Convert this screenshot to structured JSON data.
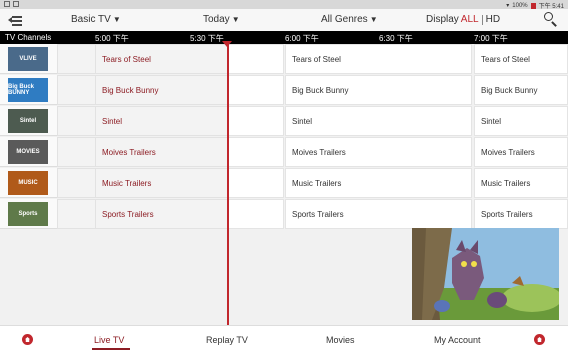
{
  "status_bar": {
    "battery": "100%",
    "time": "下午 5:41"
  },
  "top_nav": {
    "channel_group": "Basic TV",
    "day": "Today",
    "genre": "All Genres",
    "display_label": "Display",
    "display_all": "ALL",
    "display_hd": "HD"
  },
  "time_header": {
    "tv_channels_label": "TV Channels",
    "slots": [
      "5:00 下午",
      "5:30 下午",
      "6:00 下午",
      "6:30 下午",
      "7:00 下午"
    ]
  },
  "channels": [
    {
      "logo_text": "VLIVE",
      "logo_color": "#4a6a8a",
      "programs": [
        "Tears of Steel",
        "Tears of Steel",
        "Tears of Steel"
      ]
    },
    {
      "logo_text": "Big Buck BUNNY",
      "logo_color": "#2f7cc2",
      "programs": [
        "Big Buck Bunny",
        "Big Buck Bunny",
        "Big Buck Bunny"
      ]
    },
    {
      "logo_text": "Sintel",
      "logo_color": "#4d5b50",
      "programs": [
        "Sintel",
        "Sintel",
        "Sintel"
      ]
    },
    {
      "logo_text": "MOVIES",
      "logo_color": "#5a5a5a",
      "programs": [
        "Moives Trailers",
        "Moives Trailers",
        "Moives Trailers"
      ]
    },
    {
      "logo_text": "MUSIC",
      "logo_color": "#b05a1a",
      "programs": [
        "Music Trailers",
        "Music Trailers",
        "Music Trailers"
      ]
    },
    {
      "logo_text": "Sports",
      "logo_color": "#5f7a4a",
      "programs": [
        "Sports Trailers",
        "Sports Trailers",
        "Sports Trailers"
      ]
    }
  ],
  "bottom_nav": {
    "tabs": [
      "Live TV",
      "Replay TV",
      "Movies",
      "My Account"
    ],
    "active_tab": "Live TV"
  },
  "colors": {
    "accent": "#c1272d",
    "past_program_text": "#8c1c23"
  }
}
